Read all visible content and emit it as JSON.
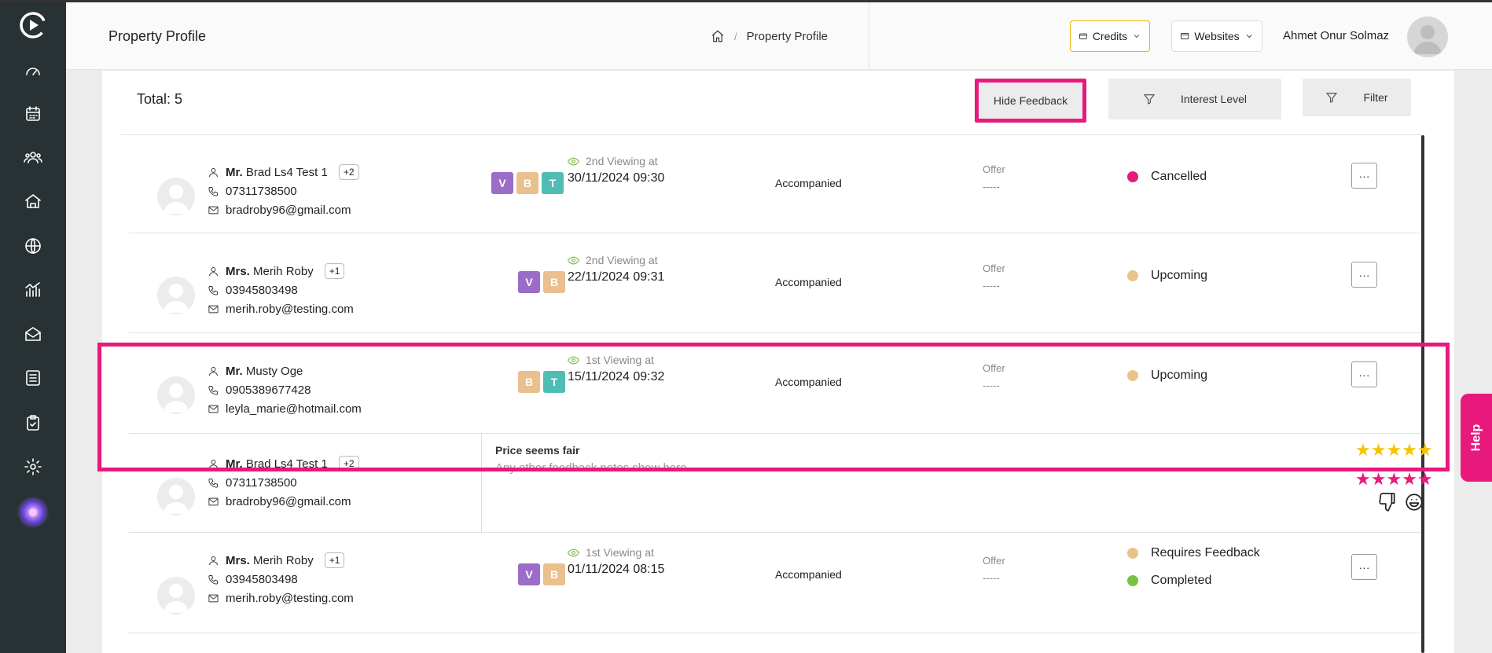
{
  "header": {
    "title": "Property Profile",
    "breadcrumb": "Property Profile",
    "credits_label": "Credits",
    "websites_label": "Websites",
    "user_name": "Ahmet Onur Solmaz"
  },
  "toolbar": {
    "total": "Total: 5",
    "hide_feedback": "Hide Feedback",
    "interest_level": "Interest Level",
    "filter": "Filter"
  },
  "rows": [
    {
      "title": "Mr.",
      "name": "Brad Ls4 Test 1",
      "extra": "+2",
      "phone": "07311738500",
      "email": "bradroby96@gmail.com",
      "tags": [
        "V",
        "B",
        "T"
      ],
      "viewing_label": "2nd Viewing at",
      "viewing_date": "30/11/2024 09:30",
      "accompanied": "Accompanied",
      "offer_label": "Offer",
      "offer_value": "-----",
      "statuses": [
        {
          "label": "Cancelled",
          "color": "#e8197d"
        }
      ],
      "more": "···"
    },
    {
      "title": "Mrs.",
      "name": "Merih Roby",
      "extra": "+1",
      "phone": "03945803498",
      "email": "merih.roby@testing.com",
      "tags": [
        "V",
        "B"
      ],
      "viewing_label": "2nd Viewing at",
      "viewing_date": "22/11/2024 09:31",
      "accompanied": "Accompanied",
      "offer_label": "Offer",
      "offer_value": "-----",
      "statuses": [
        {
          "label": "Upcoming",
          "color": "#e8c48c"
        }
      ],
      "more": "···"
    },
    {
      "title": "Mr.",
      "name": "Musty Oge",
      "extra": "",
      "phone": "0905389677428",
      "email": "leyla_marie@hotmail.com",
      "tags": [
        "B",
        "T"
      ],
      "viewing_label": "1st Viewing at",
      "viewing_date": "15/11/2024 09:32",
      "accompanied": "Accompanied",
      "offer_label": "Offer",
      "offer_value": "-----",
      "statuses": [
        {
          "label": "Upcoming",
          "color": "#e8c48c"
        }
      ],
      "more": "···"
    },
    {
      "title": "Mr.",
      "name": "Brad Ls4 Test 1",
      "extra": "+2",
      "phone": "07311738500",
      "email": "bradroby96@gmail.com",
      "feedback_title": "Price seems fair",
      "feedback_notes": "Any other feedback notes show here",
      "stars_yellow": "★★★★★",
      "stars_pink": "★★★★★"
    },
    {
      "title": "Mrs.",
      "name": "Merih Roby",
      "extra": "+1",
      "phone": "03945803498",
      "email": "merih.roby@testing.com",
      "tags": [
        "V",
        "B"
      ],
      "viewing_label": "1st Viewing at",
      "viewing_date": "01/11/2024 08:15",
      "accompanied": "Accompanied",
      "offer_label": "Offer",
      "offer_value": "-----",
      "statuses": [
        {
          "label": "Requires Feedback",
          "color": "#e8c48c"
        },
        {
          "label": "Completed",
          "color": "#7cc242"
        }
      ],
      "more": "···"
    }
  ],
  "tag_colors": {
    "V": "#9b6cc8",
    "B": "#e9c08e",
    "T": "#4fbdb4"
  },
  "help_label": "Help"
}
